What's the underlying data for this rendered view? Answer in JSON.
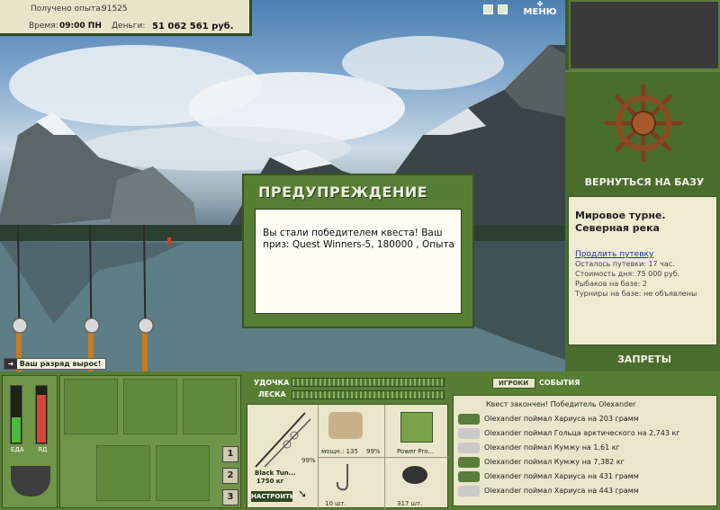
{
  "info": {
    "exp_label": "Получено опыта:",
    "exp_value": "91525",
    "time_label": "Время:",
    "time_value": "09:00 ПН",
    "money_label": "Деньги:",
    "money_value": "51 062 561 руб."
  },
  "header": {
    "menu_label": "МЕНЮ"
  },
  "dialog": {
    "title": "ПРЕДУПРЕЖДЕНИЕ",
    "message": "Вы стали победителем квеста! Ваш приз: Quest Winners-5, 180000 , Опыта"
  },
  "rank_notice": "Ваш разряд вырос!",
  "right_panel": {
    "return_label": "ВЕРНУТЬСЯ НА БАЗУ",
    "tour_title": "Мировое турне. Северная река",
    "extend_link": "Продлить путевку",
    "lines": [
      "Осталось путевки: 17 час.",
      "Стоимость дня: 75 000 руб.",
      "Рыбаков на базе: 2",
      "Турниры на базе: не объявлены"
    ],
    "bans_label": "ЗАПРЕТЫ"
  },
  "status": {
    "food_label": "ЕДА",
    "poison_label": "ЯД",
    "food_level": 0.45,
    "poison_level": 0.85
  },
  "inventory_pages": [
    "1",
    "2",
    "3"
  ],
  "tackle": {
    "rod_label": "УДОЧКА",
    "line_label": "ЛЕСКА",
    "rod_name": "Black Tun...",
    "rod_weight": "1750 кг",
    "rod_percent": "99%",
    "setup_label": "НАСТРОИТЬ",
    "reel_power": "мощн.: 135",
    "reel_percent": "99%",
    "line_name": "Power Pro...",
    "hooks_count": "10 шт.",
    "bait_count": "317 шт."
  },
  "log": {
    "tabs": [
      "ИГРОКИ",
      "СОБЫТИЯ"
    ],
    "header": "Квест закончен! Победитель Olexander",
    "entries": [
      "Olexander поймал Хариуса на 203 грамм",
      "Olexander поймал Гольца арктического на 2,743 кг",
      "Olexander поймал Кумжу на 1,61 кг",
      "Olexander поймал Кумжу на 7,382 кг",
      "Olexander поймал Хариуса на 431 грамм",
      "Olexander поймал Хариуса на 443 грамм"
    ],
    "icon_colors": [
      "#5a7d3c",
      "#c9c9c9",
      "#c9c9c9",
      "#5a7d3c",
      "#5a7d3c",
      "#c9c9c9"
    ]
  },
  "colors": {
    "accent": "#587e36",
    "panel": "#efebd2",
    "link": "#1a2fb4"
  }
}
